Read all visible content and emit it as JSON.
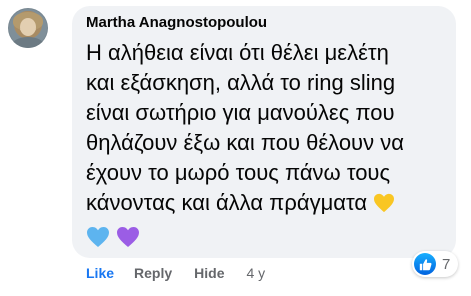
{
  "comment": {
    "author": "Martha Anagnostopoulou",
    "lines": [
      "Η αλήθεια είναι ότι θέλει μελέτη",
      "και εξάσκηση, αλλά το ring sling",
      "είναι σωτήριο για μανούλες που",
      "θηλάζουν έξω και που θέλουν να",
      "έχουν το μωρό τους πάνω τους",
      "κάνοντας και άλλα πράγματα"
    ],
    "emojis_inline": [
      "yellow-heart"
    ],
    "emojis_row": [
      "blue-heart",
      "purple-heart"
    ]
  },
  "reactions": {
    "type": "like",
    "count": "7"
  },
  "actions": {
    "like": "Like",
    "reply": "Reply",
    "hide": "Hide",
    "time": "4 y"
  },
  "colors": {
    "bubble": "#f0f2f5",
    "link_blue": "#1877f2",
    "muted": "#65676b",
    "text": "#050505"
  }
}
